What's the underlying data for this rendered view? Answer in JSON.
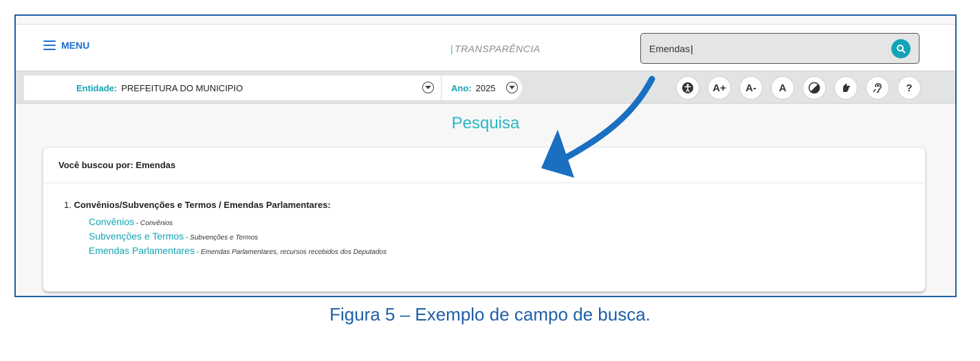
{
  "header": {
    "menu_label": "MENU",
    "brand_separator": "|",
    "brand": "TRANSPARÊNCIA",
    "search_value": "Emendas"
  },
  "filters": {
    "entity_label": "Entidade:",
    "entity_value": "PREFEITURA DO MUNICIPIO",
    "year_label": "Ano:",
    "year_value": "2025"
  },
  "accessibility": {
    "buttons": [
      {
        "icon": "accessibility-icon",
        "label": ""
      },
      {
        "icon": "increase-font-icon",
        "label": "A+"
      },
      {
        "icon": "decrease-font-icon",
        "label": "A-"
      },
      {
        "icon": "reset-font-icon",
        "label": "A"
      },
      {
        "icon": "contrast-icon",
        "label": ""
      },
      {
        "icon": "sign-language-icon",
        "label": ""
      },
      {
        "icon": "hearing-icon",
        "label": ""
      },
      {
        "icon": "help-icon",
        "label": "?"
      }
    ]
  },
  "main": {
    "page_title": "Pesquisa",
    "search_summary": "Você buscou por: Emendas",
    "result_number": "1.",
    "result_title": "Convênios/Subvenções e Termos / Emendas Parlamentares:",
    "links": [
      {
        "label": "Convênios",
        "separator": " - ",
        "description": "Convênios"
      },
      {
        "label": "Subvenções e Termos",
        "separator": " - ",
        "description": "Subvenções e Termos"
      },
      {
        "label": "Emendas Parlamentares",
        "separator": " - ",
        "description": "Emendas Parlamentares, recursos recebidos dos Deputados"
      }
    ]
  },
  "caption": "Figura 5 – Exemplo de campo de busca.",
  "colors": {
    "frame": "#1f5fa8",
    "accent": "#12a4b6",
    "menu": "#1a6fd6",
    "arrow": "#1a6fc0"
  }
}
